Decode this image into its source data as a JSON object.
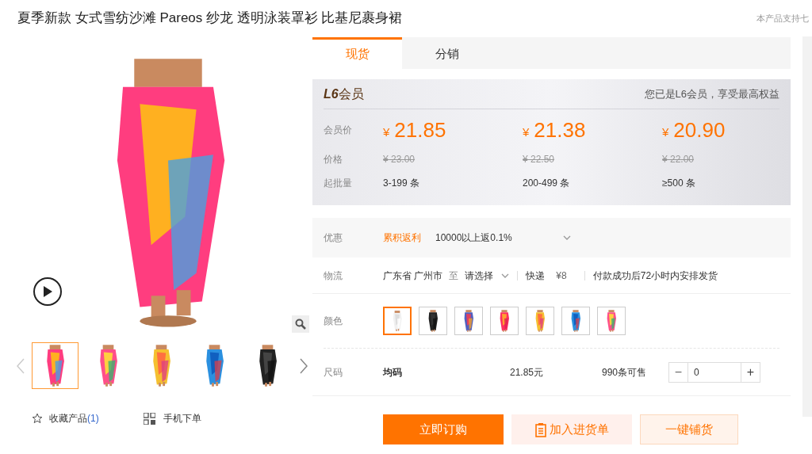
{
  "title": "夏季新款 女式雪纺沙滩 Pareos 纱龙 透明泳装罩衫 比基尼裹身裙",
  "top_note": "本产品支持七",
  "tabs": [
    {
      "label": "现货",
      "selected": true
    },
    {
      "label": "分销",
      "selected": false
    }
  ],
  "gallery": {
    "thumbnails": [
      {
        "selected": true
      },
      {
        "selected": false
      },
      {
        "selected": false
      },
      {
        "selected": false
      },
      {
        "selected": false
      }
    ],
    "favorite": "收藏产品",
    "favorite_count": "(1)",
    "mobile_order": "手机下单"
  },
  "member": {
    "level": "L6",
    "label": "会员",
    "note": "您已是L6会员，享受最高权益",
    "row_labels": [
      "会员价",
      "价格",
      "起批量"
    ],
    "tiers": [
      {
        "currency": "¥",
        "price": "21.85",
        "original": "¥ 23.00",
        "quantity": "3-199 条"
      },
      {
        "currency": "¥",
        "price": "21.38",
        "original": "¥ 22.50",
        "quantity": "200-499 条"
      },
      {
        "currency": "¥",
        "price": "20.90",
        "original": "¥ 22.00",
        "quantity": "≥500 条"
      }
    ]
  },
  "discount": {
    "label": "优惠",
    "tag": "累积返利",
    "text": "10000以上返0.1%"
  },
  "logistics": {
    "label": "物流",
    "from": "广东省 广州市",
    "to": "至",
    "destination": "请选择",
    "method": "快递",
    "fee": "¥8",
    "note": "付款成功后72小时内安排发货"
  },
  "colors": {
    "label": "颜色",
    "swatches": [
      {
        "selected": true
      },
      {
        "selected": false
      },
      {
        "selected": false
      },
      {
        "selected": false
      },
      {
        "selected": false
      },
      {
        "selected": false
      },
      {
        "selected": false
      }
    ]
  },
  "size": {
    "label": "尺码",
    "value": "均码",
    "price": "21.85元",
    "stock": "990条可售",
    "minus": "−",
    "quantity": "0",
    "plus": "+"
  },
  "buttons": [
    {
      "kind": "primary",
      "label": "立即订购"
    },
    {
      "kind": "cart",
      "label": "加入进货单"
    },
    {
      "kind": "outline",
      "label": "一键铺货"
    }
  ]
}
